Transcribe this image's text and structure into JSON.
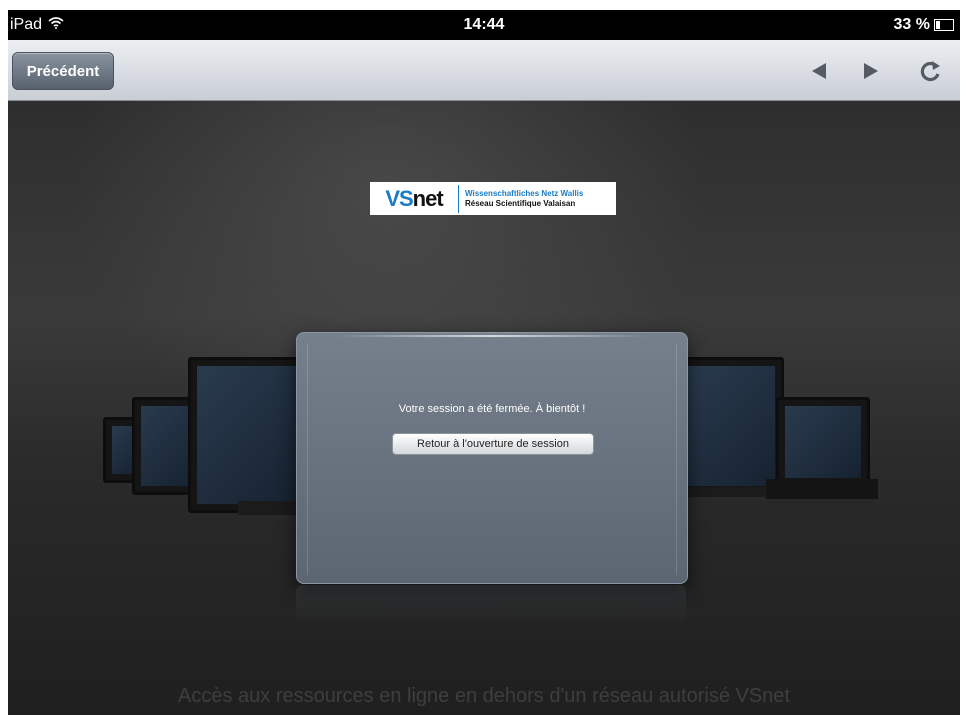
{
  "status_bar": {
    "device": "iPad",
    "wifi_icon": "wifi-icon",
    "time": "14:44",
    "battery": "33 %",
    "battery_level": 0.33
  },
  "toolbar": {
    "back_label": "Précédent",
    "icons": [
      "back-arrow-icon",
      "forward-arrow-icon",
      "reload-icon"
    ]
  },
  "logo": {
    "word_vs": "VS",
    "word_net": "net",
    "line1": "Wissenschaftliches Netz Wallis",
    "line2": "Réseau Scientifique Valaisan"
  },
  "dialog": {
    "message": "Votre session a été fermée. À bientôt !",
    "button_label": "Retour à l'ouverture de session"
  },
  "footer": {
    "text": "Accès aux ressources en ligne en dehors d'un réseau autorisé VSnet"
  },
  "colors": {
    "brand_blue": "#1a7cc6",
    "background": "#2e2e2e",
    "dialog": "#6b7581"
  }
}
